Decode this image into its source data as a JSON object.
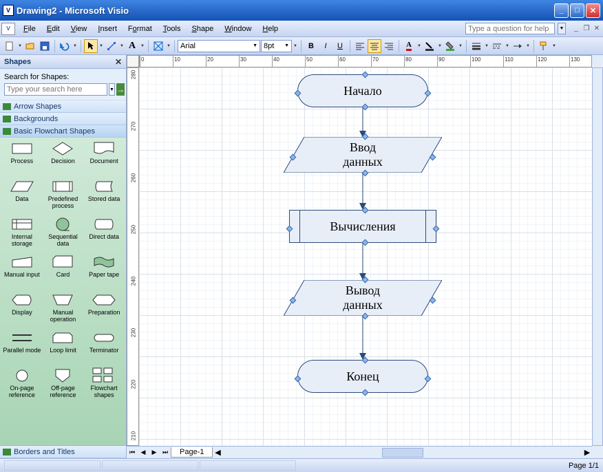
{
  "window": {
    "title": "Drawing2 - Microsoft Visio"
  },
  "menu": {
    "items": [
      "File",
      "Edit",
      "View",
      "Insert",
      "Format",
      "Tools",
      "Shape",
      "Window",
      "Help"
    ]
  },
  "help_search": {
    "placeholder": "Type a question for help"
  },
  "toolbar": {
    "font": "Arial",
    "size": "8pt"
  },
  "shapes_panel": {
    "title": "Shapes",
    "search_label": "Search for Shapes:",
    "search_placeholder": "Type your search here",
    "stencils": [
      "Arrow Shapes",
      "Backgrounds",
      "Basic Flowchart Shapes",
      "Borders and Titles"
    ],
    "shapes": [
      "Process",
      "Decision",
      "Document",
      "Data",
      "Predefined process",
      "Stored data",
      "Internal storage",
      "Sequential data",
      "Direct data",
      "Manual input",
      "Card",
      "Paper tape",
      "Display",
      "Manual operation",
      "Preparation",
      "Parallel mode",
      "Loop limit",
      "Terminator",
      "On-page reference",
      "Off-page reference",
      "Flowchart shapes"
    ]
  },
  "flowchart": {
    "start": "Начало",
    "input": "Ввод\nданных",
    "process": "Вычисления",
    "output": "Вывод\nданных",
    "end": "Конец"
  },
  "ruler_h": [
    "0",
    "10",
    "20",
    "30",
    "40",
    "50",
    "60",
    "70",
    "80",
    "90",
    "100",
    "110",
    "120",
    "130"
  ],
  "ruler_v": [
    "280",
    "270",
    "260",
    "250",
    "240",
    "230",
    "220",
    "210"
  ],
  "page_tab": "Page-1",
  "status": {
    "page": "Page 1/1"
  }
}
